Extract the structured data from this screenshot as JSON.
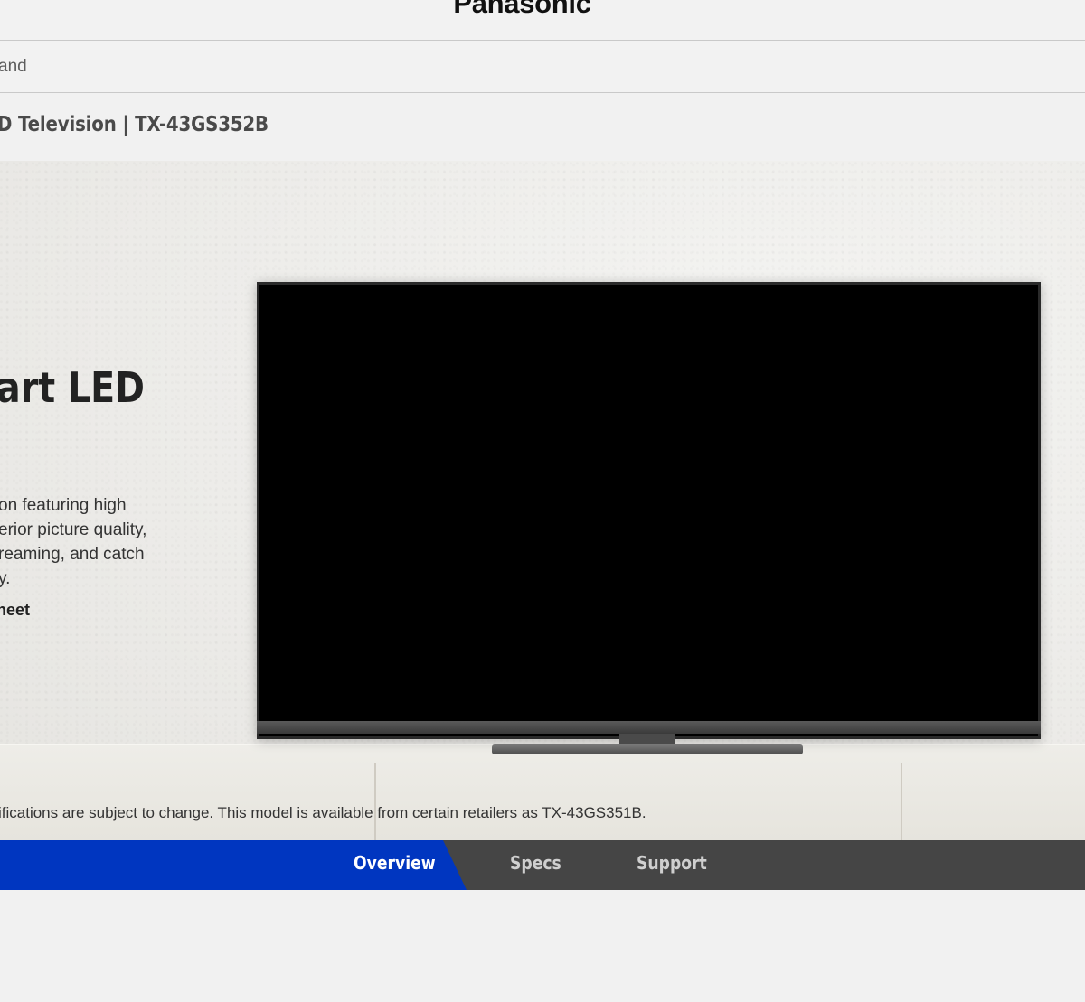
{
  "header": {
    "brand": "Panasonic"
  },
  "breadcrumb": {
    "text": "and"
  },
  "product": {
    "title": "D Television | TX-43GS352B"
  },
  "hero": {
    "heading": "art LED",
    "description": [
      "on featuring high",
      "erior picture quality,",
      "reaming, and catch",
      "y."
    ],
    "link_label": "heet",
    "disclaimer": "ifications are subject to change. This model is available from certain retailers as TX-43GS351B."
  },
  "tabs": [
    {
      "label": "Overview",
      "active": true
    },
    {
      "label": "Specs",
      "active": false
    },
    {
      "label": "Support",
      "active": false
    }
  ],
  "colors": {
    "active_tab": "#0036c0",
    "tab_bar": "#454545"
  }
}
